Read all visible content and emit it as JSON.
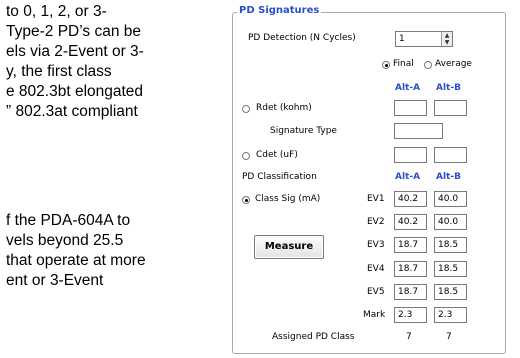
{
  "document": {
    "lines": [
      "to 0, 1, 2, or 3-",
      "Type-2 PD’s can be",
      "els via 2-Event or 3-",
      "y, the first class",
      "e 802.3bt elongated",
      "” 802.3at compliant",
      "",
      "",
      "f the PDA-604A to",
      "vels beyond 25.5",
      "that operate at more",
      "ent or 3-Event"
    ]
  },
  "panel": {
    "title": "PD Signatures",
    "detection_label": "PD Detection (N Cycles)",
    "detection_value": "1",
    "mode_final": "Final",
    "mode_average": "Average",
    "col_a": "Alt-A",
    "col_b": "Alt-B",
    "rdet_label": "Rdet (kohm)",
    "signature_type_label": "Signature Type",
    "cdet_label": "Cdet (uF)",
    "classification_label": "PD Classification",
    "class_sig_label": "Class Sig (mA)",
    "measure_label": "Measure",
    "rows": [
      {
        "label": "EV1",
        "a": "40.2",
        "b": "40.0"
      },
      {
        "label": "EV2",
        "a": "40.2",
        "b": "40.0"
      },
      {
        "label": "EV3",
        "a": "18.7",
        "b": "18.5"
      },
      {
        "label": "EV4",
        "a": "18.7",
        "b": "18.5"
      },
      {
        "label": "EV5",
        "a": "18.7",
        "b": "18.5"
      },
      {
        "label": "Mark",
        "a": "2.3",
        "b": "2.3"
      }
    ],
    "assigned_label": "Assigned PD Class",
    "assigned_a": "7",
    "assigned_b": "7"
  }
}
